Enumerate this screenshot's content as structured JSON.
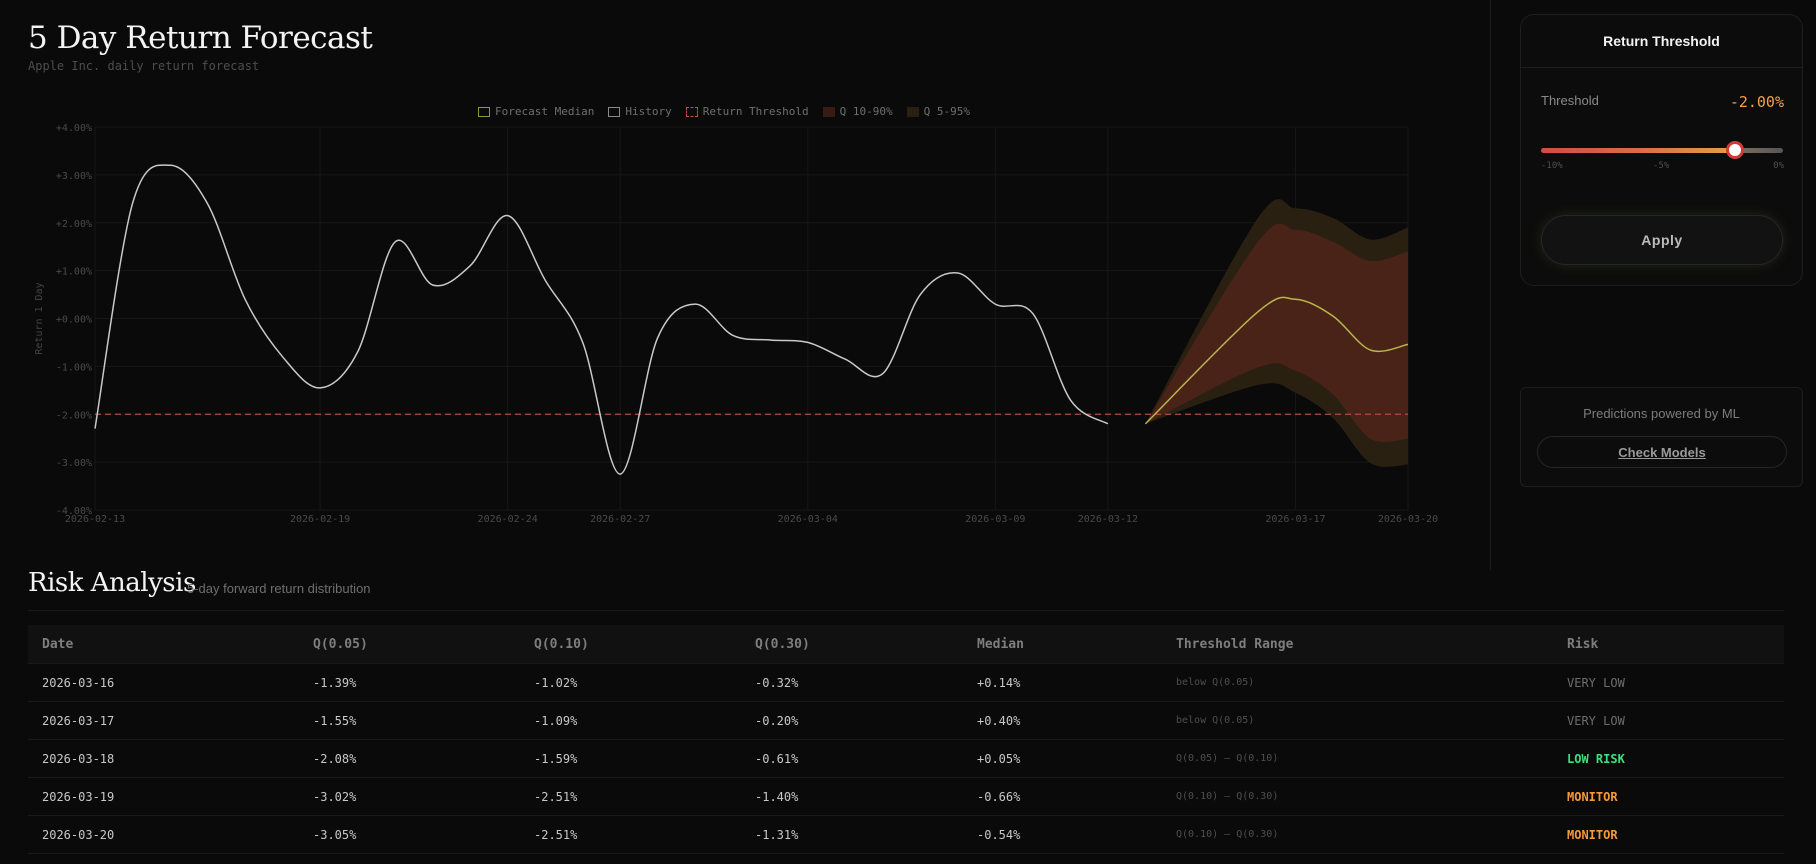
{
  "header": {
    "title": "5 Day Return Forecast",
    "subtitle": "Apple Inc. daily return forecast"
  },
  "colors": {
    "background": "#0a0a0a",
    "history_line": "#c9c9c9",
    "forecast_median": "#b9b64a",
    "threshold_line": "#c0504a",
    "q10_90": "#5a2a1e",
    "q5_95": "#2a2012",
    "accent_orange": "#f5a04d",
    "low_risk_green": "#3ee07d"
  },
  "chart_data": {
    "type": "line",
    "ylabel": "Return 1 Day",
    "ylim": [
      -4,
      4
    ],
    "y_ticks": [
      "+4.00%",
      "+3.00%",
      "+2.00%",
      "+1.00%",
      "+0.00%",
      "-1.00%",
      "-2.00%",
      "-3.00%",
      "-4.00%"
    ],
    "y_tick_values": [
      4,
      3,
      2,
      1,
      0,
      -1,
      -2,
      -3,
      -4
    ],
    "x_range": [
      "2026-02-13",
      "2026-03-20"
    ],
    "x_ticks": [
      "2026-02-13",
      "2026-02-19",
      "2026-02-24",
      "2026-02-27",
      "2026-03-04",
      "2026-03-09",
      "2026-03-12",
      "2026-03-17",
      "2026-03-20"
    ],
    "legend": [
      {
        "label": "Forecast Median",
        "style": "forecast"
      },
      {
        "label": "History",
        "style": "history"
      },
      {
        "label": "Return Threshold",
        "style": "threshold"
      },
      {
        "label": "Q 10-90%",
        "style": "q1090"
      },
      {
        "label": "Q 5-95%",
        "style": "q595"
      }
    ],
    "threshold": -2.0,
    "series": [
      {
        "name": "History",
        "points": [
          [
            "2026-02-13",
            -2.3
          ],
          [
            "2026-02-14",
            2.4
          ],
          [
            "2026-02-15",
            3.2
          ],
          [
            "2026-02-16",
            2.4
          ],
          [
            "2026-02-17",
            0.4
          ],
          [
            "2026-02-18",
            -0.8
          ],
          [
            "2026-02-19",
            -1.45
          ],
          [
            "2026-02-20",
            -0.7
          ],
          [
            "2026-02-21",
            1.6
          ],
          [
            "2026-02-22",
            0.7
          ],
          [
            "2026-02-23",
            1.1
          ],
          [
            "2026-02-24",
            2.15
          ],
          [
            "2026-02-25",
            0.8
          ],
          [
            "2026-02-26",
            -0.5
          ],
          [
            "2026-02-27",
            -3.25
          ],
          [
            "2026-02-28",
            -0.4
          ],
          [
            "2026-03-01",
            0.3
          ],
          [
            "2026-03-02",
            -0.35
          ],
          [
            "2026-03-03",
            -0.45
          ],
          [
            "2026-03-04",
            -0.5
          ],
          [
            "2026-03-05",
            -0.85
          ],
          [
            "2026-03-06",
            -1.15
          ],
          [
            "2026-03-07",
            0.5
          ],
          [
            "2026-03-08",
            0.95
          ],
          [
            "2026-03-09",
            0.3
          ],
          [
            "2026-03-10",
            0.1
          ],
          [
            "2026-03-11",
            -1.7
          ],
          [
            "2026-03-12",
            -2.2
          ]
        ]
      },
      {
        "name": "Forecast Median",
        "points": [
          [
            "2026-03-13",
            -2.2
          ],
          [
            "2026-03-16",
            0.14
          ],
          [
            "2026-03-17",
            0.4
          ],
          [
            "2026-03-18",
            0.05
          ],
          [
            "2026-03-19",
            -0.66
          ],
          [
            "2026-03-20",
            -0.54
          ]
        ]
      }
    ],
    "bands": {
      "q10_90": {
        "lower": [
          [
            "2026-03-13",
            -2.2
          ],
          [
            "2026-03-16",
            -1.02
          ],
          [
            "2026-03-17",
            -1.09
          ],
          [
            "2026-03-18",
            -1.59
          ],
          [
            "2026-03-19",
            -2.51
          ],
          [
            "2026-03-20",
            -2.51
          ]
        ],
        "upper": [
          [
            "2026-03-13",
            -2.2
          ],
          [
            "2026-03-16",
            1.6
          ],
          [
            "2026-03-17",
            1.85
          ],
          [
            "2026-03-18",
            1.6
          ],
          [
            "2026-03-19",
            1.2
          ],
          [
            "2026-03-20",
            1.4
          ]
        ]
      },
      "q5_95": {
        "lower": [
          [
            "2026-03-13",
            -2.2
          ],
          [
            "2026-03-16",
            -1.39
          ],
          [
            "2026-03-17",
            -1.55
          ],
          [
            "2026-03-18",
            -2.08
          ],
          [
            "2026-03-19",
            -3.02
          ],
          [
            "2026-03-20",
            -3.05
          ]
        ],
        "upper": [
          [
            "2026-03-13",
            -2.2
          ],
          [
            "2026-03-16",
            2.1
          ],
          [
            "2026-03-17",
            2.3
          ],
          [
            "2026-03-18",
            2.1
          ],
          [
            "2026-03-19",
            1.65
          ],
          [
            "2026-03-20",
            1.9
          ]
        ]
      }
    }
  },
  "sidebar": {
    "threshold_card": {
      "title": "Return Threshold",
      "label": "Threshold",
      "value": "-2.00%",
      "slider_fraction": 0.8,
      "ticks": [
        "-10%",
        "-5%",
        "0%"
      ],
      "apply_label": "Apply"
    },
    "ml_card": {
      "text": "Predictions powered by ML",
      "button_label": "Check Models"
    }
  },
  "risk": {
    "title": "Risk Analysis",
    "subtitle": "5-day forward return distribution",
    "columns": [
      "Date",
      "Q(0.05)",
      "Q(0.10)",
      "Q(0.30)",
      "Median",
      "Threshold Range",
      "Risk"
    ],
    "rows": [
      {
        "date": "2026-03-16",
        "q05": "-1.39%",
        "q10": "-1.02%",
        "q30": "-0.32%",
        "median": "+0.14%",
        "range": "below Q(0.05)",
        "risk": "VERY LOW",
        "level": "very-low"
      },
      {
        "date": "2026-03-17",
        "q05": "-1.55%",
        "q10": "-1.09%",
        "q30": "-0.20%",
        "median": "+0.40%",
        "range": "below Q(0.05)",
        "risk": "VERY LOW",
        "level": "very-low"
      },
      {
        "date": "2026-03-18",
        "q05": "-2.08%",
        "q10": "-1.59%",
        "q30": "-0.61%",
        "median": "+0.05%",
        "range": "Q(0.05) – Q(0.10)",
        "risk": "LOW RISK",
        "level": "low"
      },
      {
        "date": "2026-03-19",
        "q05": "-3.02%",
        "q10": "-2.51%",
        "q30": "-1.40%",
        "median": "-0.66%",
        "range": "Q(0.10) – Q(0.30)",
        "risk": "MONITOR",
        "level": "monitor"
      },
      {
        "date": "2026-03-20",
        "q05": "-3.05%",
        "q10": "-2.51%",
        "q30": "-1.31%",
        "median": "-0.54%",
        "range": "Q(0.10) – Q(0.30)",
        "risk": "MONITOR",
        "level": "monitor"
      }
    ]
  }
}
